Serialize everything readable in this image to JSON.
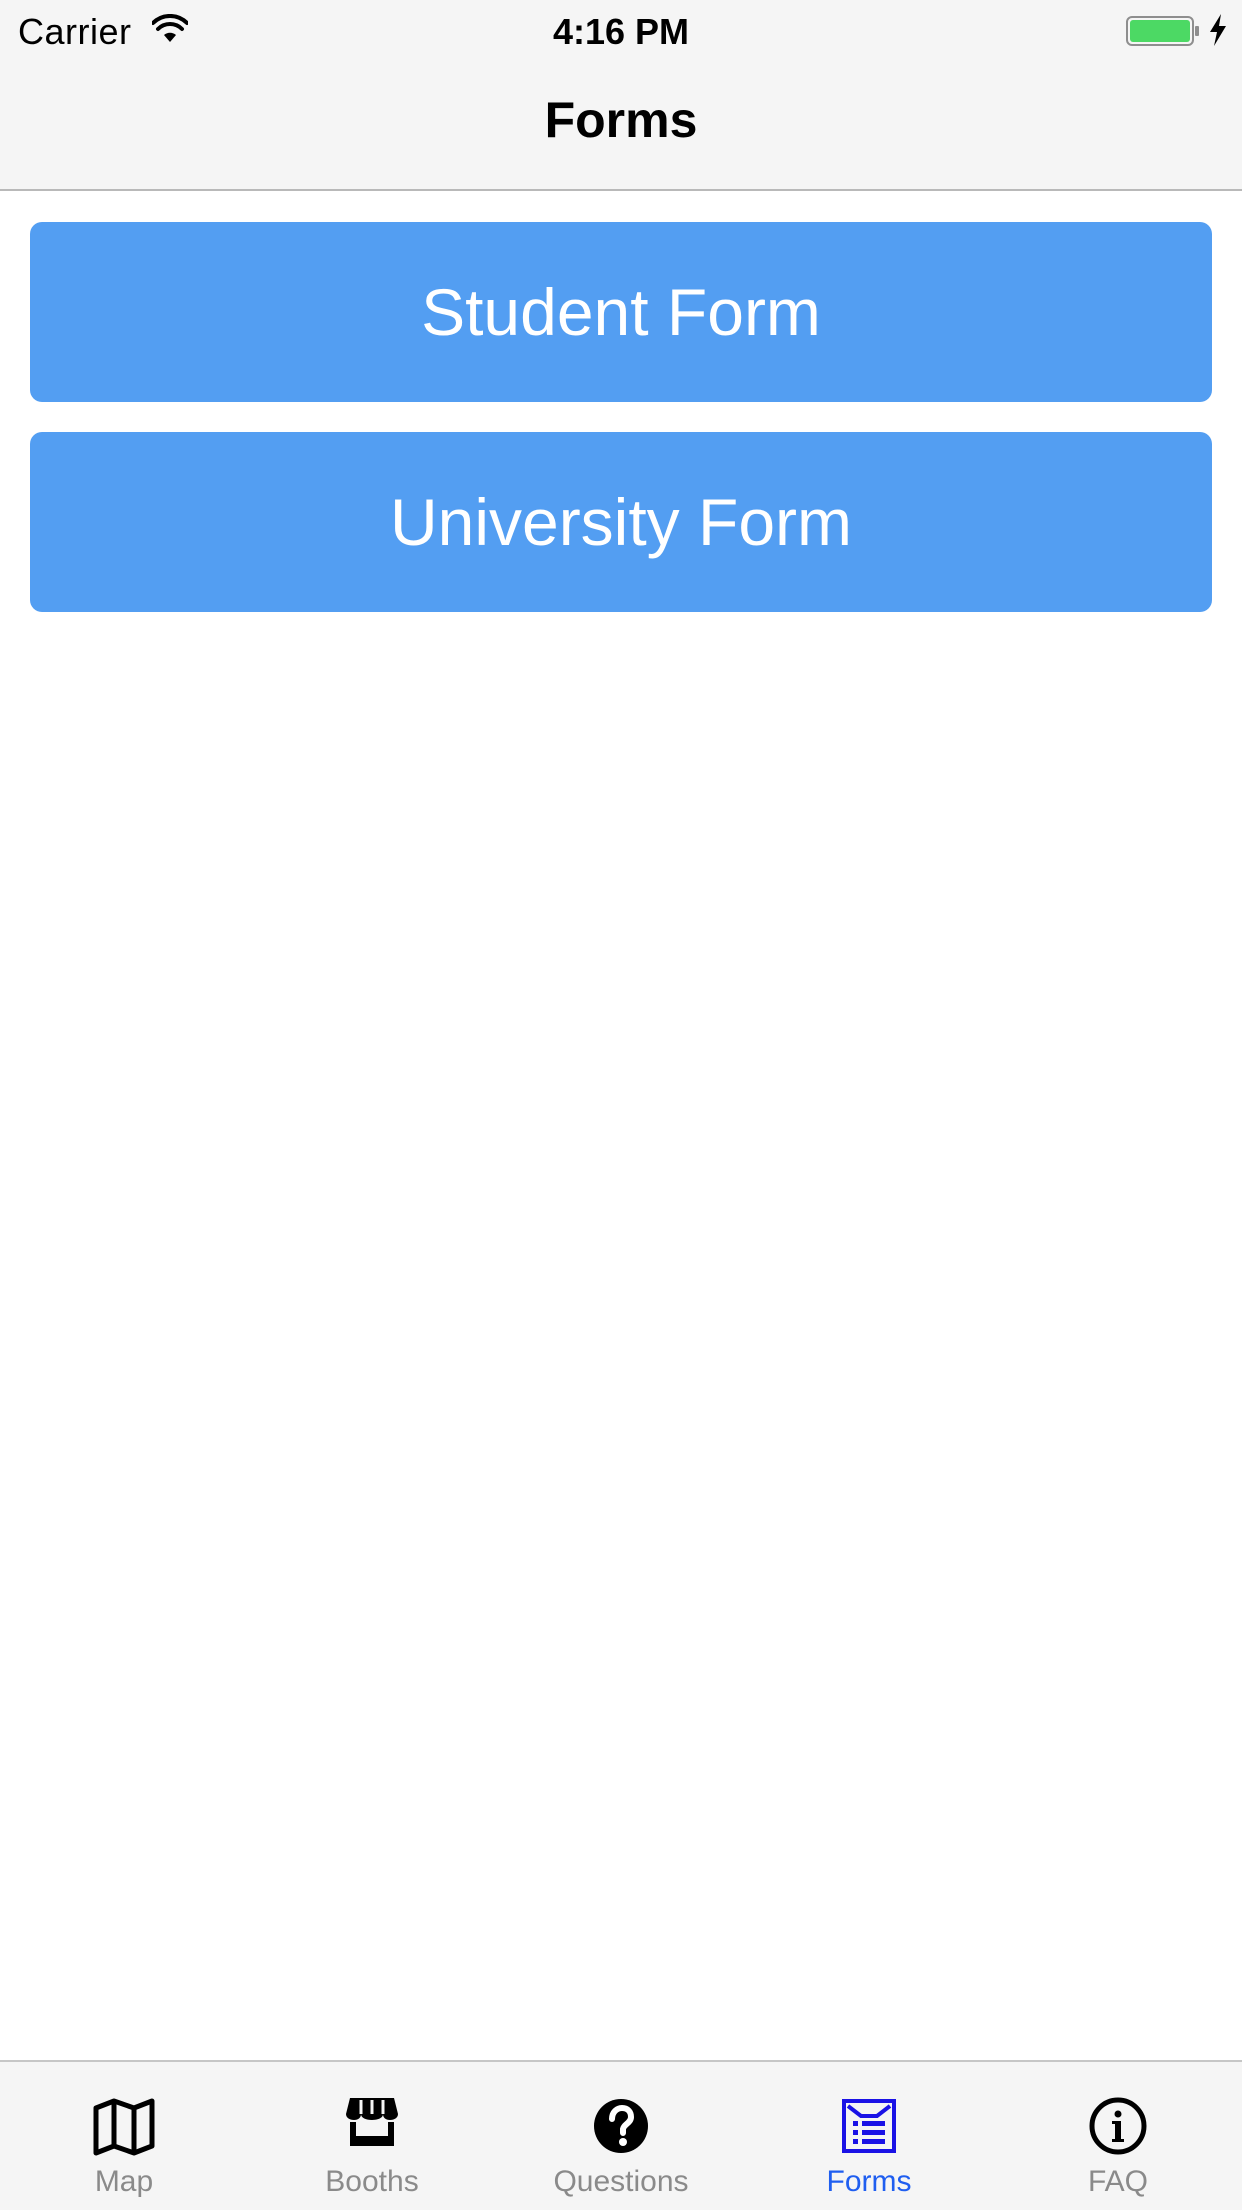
{
  "status_bar": {
    "carrier": "Carrier",
    "time": "4:16 PM",
    "battery_color": "#4cd964"
  },
  "nav": {
    "title": "Forms"
  },
  "buttons": [
    {
      "label": "Student Form"
    },
    {
      "label": "University Form"
    }
  ],
  "button_color": "#539ef2",
  "tab_bar": {
    "active_index": 3,
    "active_color": "#1f5ef0",
    "inactive_color": "#8a8a8a",
    "tabs": [
      {
        "label": "Map",
        "icon": "map-icon"
      },
      {
        "label": "Booths",
        "icon": "store-icon"
      },
      {
        "label": "Questions",
        "icon": "question-circle-icon"
      },
      {
        "label": "Forms",
        "icon": "form-document-icon"
      },
      {
        "label": "FAQ",
        "icon": "info-circle-icon"
      }
    ]
  }
}
